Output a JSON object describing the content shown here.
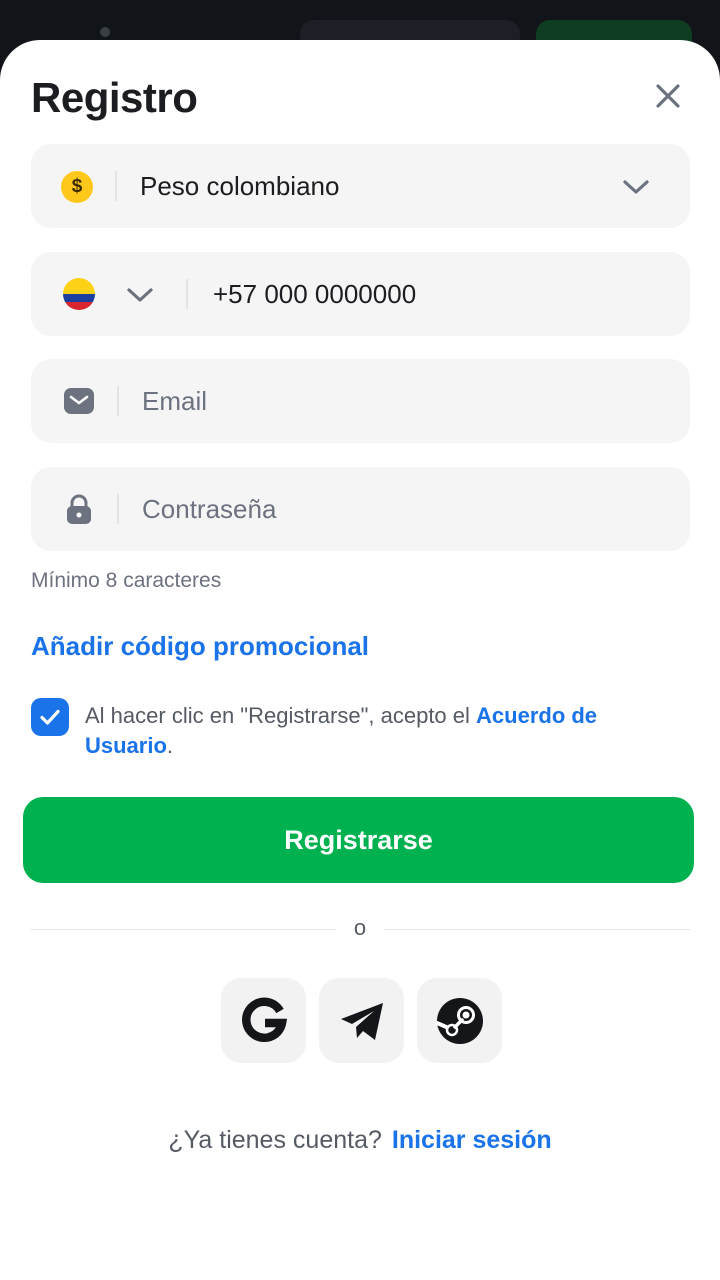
{
  "header": {
    "title": "Registro"
  },
  "currency": {
    "icon": "dollar-coin-icon",
    "symbol": "$",
    "value": "Peso colombiano"
  },
  "phone": {
    "country_flag": "colombia-flag-icon",
    "value": "+57 000 0000000"
  },
  "email": {
    "placeholder": "Email"
  },
  "password": {
    "placeholder": "Contraseña",
    "hint": "Mínimo 8 caracteres"
  },
  "promo": {
    "label": "Añadir código promocional"
  },
  "agreement": {
    "checked": true,
    "text_before": "Al hacer clic en \"Registrarse\", acepto el ",
    "link": "Acuerdo de Usuario",
    "text_after": "."
  },
  "submit": {
    "label": "Registrarse"
  },
  "divider": {
    "label": "o"
  },
  "social": [
    {
      "name": "google",
      "icon": "google-icon"
    },
    {
      "name": "telegram",
      "icon": "telegram-icon"
    },
    {
      "name": "steam",
      "icon": "steam-icon"
    }
  ],
  "footer": {
    "question": "¿Ya tienes cuenta?",
    "login_link": "Iniciar sesión"
  },
  "colors": {
    "accent": "#1a73e8",
    "primary": "#00b14f",
    "field_bg": "#f5f5f6"
  }
}
